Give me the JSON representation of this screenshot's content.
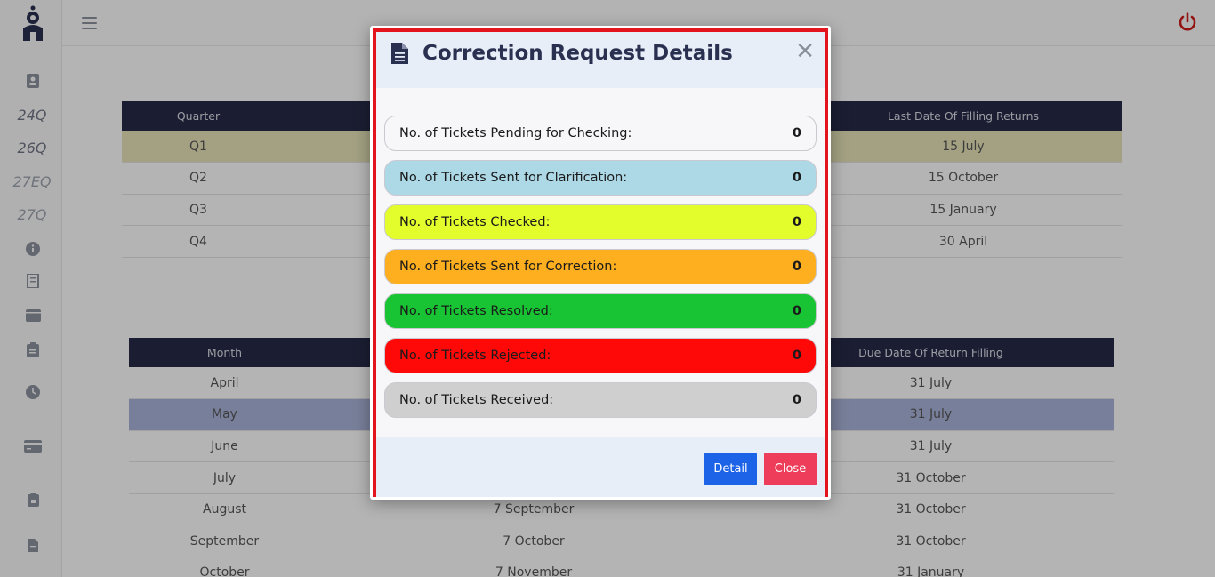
{
  "sidebar": {
    "text_items": [
      {
        "label": "24Q"
      },
      {
        "label": "26Q"
      },
      {
        "label": "27EQ"
      },
      {
        "label": "27Q"
      }
    ]
  },
  "quarter_table": {
    "headers": [
      "Quarter",
      "Last Date Of Filling Returns"
    ],
    "rows": [
      {
        "quarter": "Q1",
        "last_date": "15 July"
      },
      {
        "quarter": "Q2",
        "last_date": "15 October"
      },
      {
        "quarter": "Q3",
        "last_date": "15 January"
      },
      {
        "quarter": "Q4",
        "last_date": "30 April"
      }
    ]
  },
  "month_table": {
    "headers": [
      "Month",
      "",
      "Due Date Of Return Filling"
    ],
    "rows": [
      {
        "month": "April",
        "mid": "",
        "due": "31 July"
      },
      {
        "month": "May",
        "mid": "",
        "due": "31 July"
      },
      {
        "month": "June",
        "mid": "",
        "due": "31 July"
      },
      {
        "month": "July",
        "mid": "",
        "due": "31 October"
      },
      {
        "month": "August",
        "mid": "7 September",
        "due": "31 October"
      },
      {
        "month": "September",
        "mid": "7 October",
        "due": "31 October"
      },
      {
        "month": "October",
        "mid": "7 November",
        "due": "31 January"
      }
    ]
  },
  "modal": {
    "title": "Correction Request Details",
    "close_symbol": "✕",
    "stats": [
      {
        "label": "No. of Tickets Pending for Checking:",
        "value": "0",
        "color": "#f7f7fa"
      },
      {
        "label": "No. of Tickets Sent for Clarification:",
        "value": "0",
        "color": "#add8e6"
      },
      {
        "label": "No. of Tickets Checked:",
        "value": "0",
        "color": "#e3fc2c"
      },
      {
        "label": "No. of Tickets Sent for Correction:",
        "value": "0",
        "color": "#fdaf1f"
      },
      {
        "label": "No. of Tickets Resolved:",
        "value": "0",
        "color": "#18c433"
      },
      {
        "label": "No. of Tickets Rejected:",
        "value": "0",
        "color": "#fe0808"
      },
      {
        "label": "No. of Tickets Received:",
        "value": "0",
        "color": "#cfcfcf"
      }
    ],
    "buttons": {
      "detail": "Detail",
      "close": "Close"
    }
  },
  "colors": {
    "accent_red_border": "#e3141e",
    "header_navy": "#262a46",
    "detail_button": "#1d63e8",
    "close_button": "#ed3d5a",
    "power_icon": "#cc1a1a"
  }
}
